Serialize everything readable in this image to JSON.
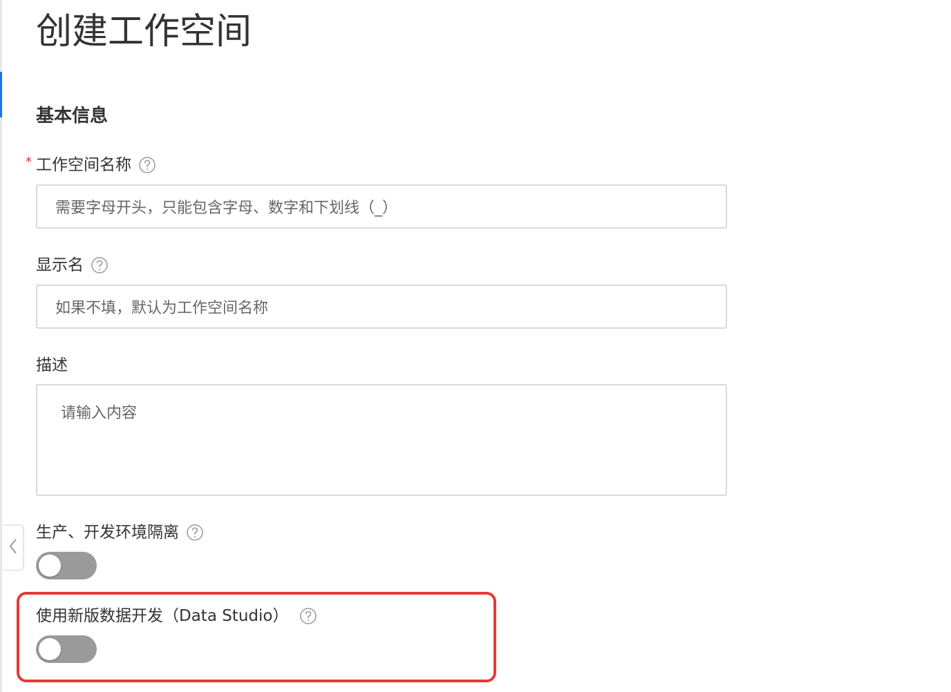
{
  "page": {
    "title": "创建工作空间",
    "section_title": "基本信息"
  },
  "form": {
    "workspace_name": {
      "label": "工作空间名称",
      "required_mark": "*",
      "placeholder": "需要字母开头，只能包含字母、数字和下划线（_）"
    },
    "display_name": {
      "label": "显示名",
      "placeholder": "如果不填，默认为工作空间名称"
    },
    "description": {
      "label": "描述",
      "placeholder": "请输入内容"
    },
    "env_isolation": {
      "label": "生产、开发环境隔离",
      "enabled": false
    },
    "data_studio": {
      "label": "使用新版数据开发（Data Studio）",
      "enabled": false
    }
  },
  "icons": {
    "help": "question-circle-icon",
    "collapse": "chevron-left-icon"
  },
  "colors": {
    "accent": "#1a73e8",
    "required": "#d93026",
    "highlight": "#e53935",
    "toggle_off": "#9a9a9a"
  }
}
